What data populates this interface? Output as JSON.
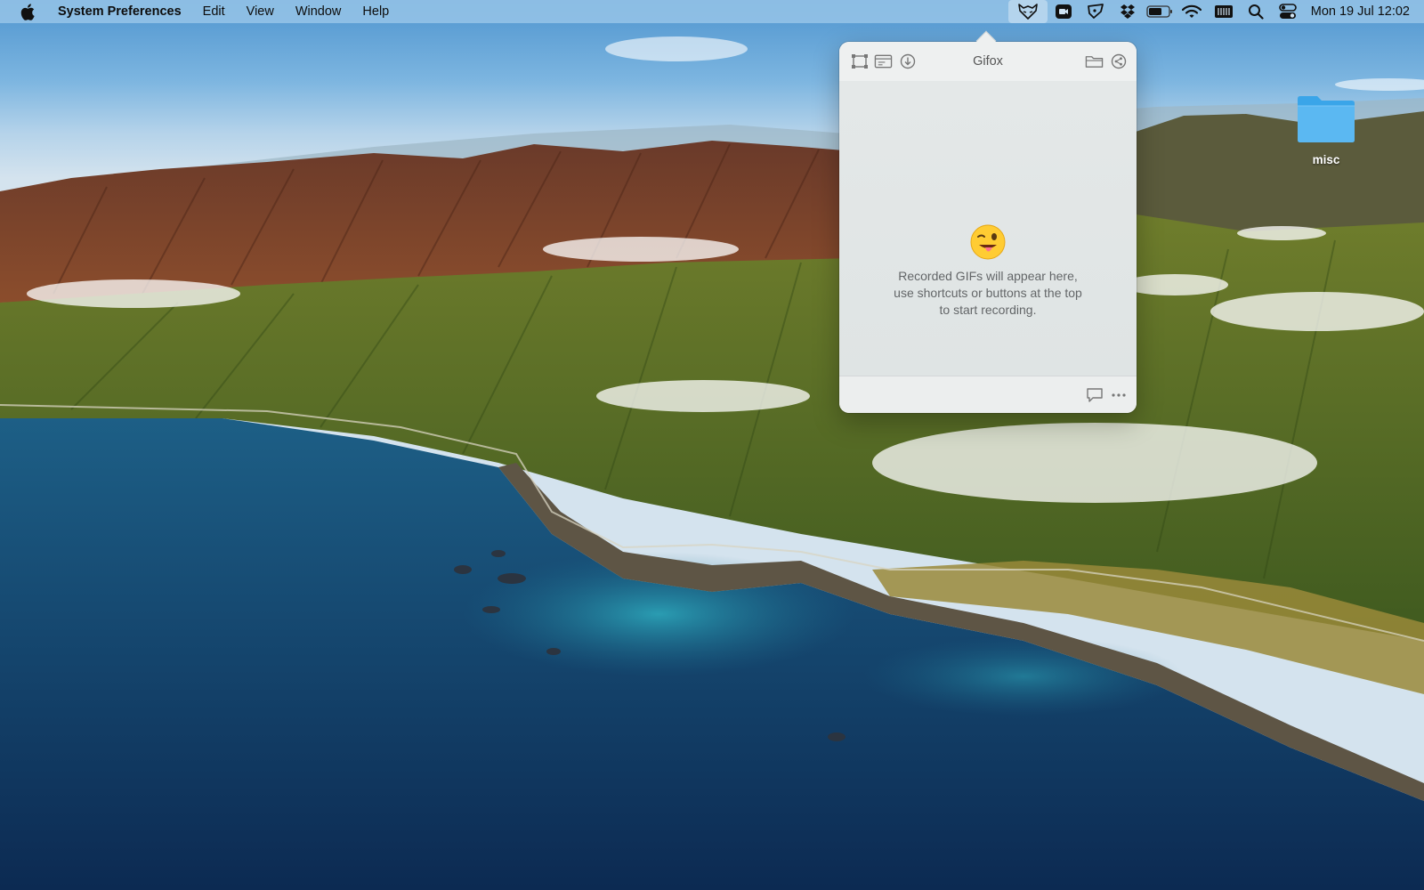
{
  "menubar": {
    "apple_icon": "apple-logo-icon",
    "app_name": "System Preferences",
    "menus": [
      "Edit",
      "View",
      "Window",
      "Help"
    ],
    "status_icons": [
      "gifox-icon",
      "video-camera-icon",
      "pen-tool-icon",
      "dropbox-icon",
      "battery-icon",
      "wifi-icon",
      "keyboard-icon",
      "search-icon",
      "control-center-icon"
    ],
    "clock": "Mon 19 Jul  12:02"
  },
  "gifox": {
    "title": "Gifox",
    "toolbar_left": [
      "record-area-icon",
      "record-window-icon",
      "download-icon"
    ],
    "toolbar_right": [
      "folder-icon",
      "share-icon"
    ],
    "empty_emoji": "winking-face-with-tongue",
    "empty_message": "Recorded GIFs will appear here,\nuse shortcuts or buttons at the top\nto start recording.",
    "footer_icons": [
      "feedback-icon",
      "more-icon"
    ]
  },
  "desktop": {
    "folder_label": "misc"
  },
  "colors": {
    "folder_blue": "#2fa2ea",
    "menubar_bg": "#96c4e8",
    "popover_bg": "#e9ecec"
  }
}
